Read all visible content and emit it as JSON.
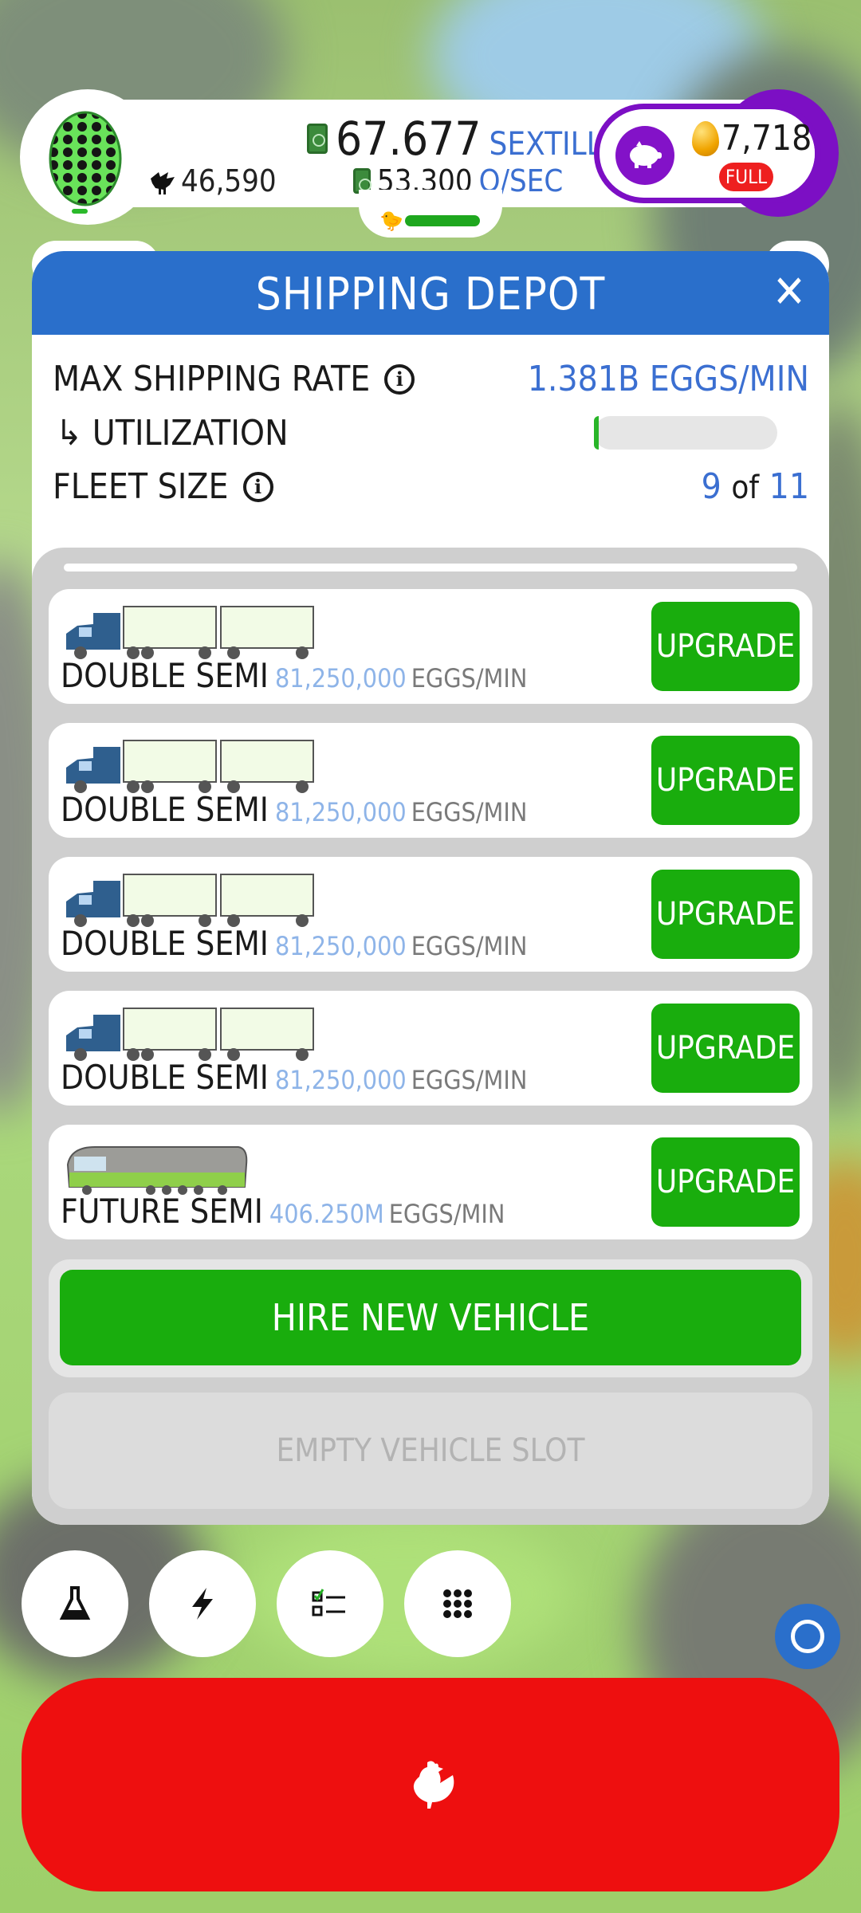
{
  "hud": {
    "chicken_count": "46,590",
    "money_amount": "67.677",
    "money_unit": "SEXTILLION",
    "rate_amount": "53.300",
    "rate_unit": "Q/SEC",
    "golden_eggs": "7,718",
    "bank_status": "FULL",
    "habitat_fill": 1.0
  },
  "panel": {
    "title": "SHIPPING DEPOT",
    "close": "✕",
    "max_rate_label": "MAX SHIPPING RATE",
    "max_rate_value": "1.381B EGGS/MIN",
    "utilization_label": "↳ UTILIZATION",
    "utilization_fraction": 0.02,
    "fleet_label": "FLEET SIZE",
    "fleet_count": "9",
    "fleet_of": "of",
    "fleet_max": "11"
  },
  "vehicles": [
    {
      "name": "DOUBLE SEMI",
      "rate": "81,250,000",
      "unit": "EGGS/MIN",
      "button": "UPGRADE"
    },
    {
      "name": "DOUBLE SEMI",
      "rate": "81,250,000",
      "unit": "EGGS/MIN",
      "button": "UPGRADE"
    },
    {
      "name": "DOUBLE SEMI",
      "rate": "81,250,000",
      "unit": "EGGS/MIN",
      "button": "UPGRADE"
    },
    {
      "name": "DOUBLE SEMI",
      "rate": "81,250,000",
      "unit": "EGGS/MIN",
      "button": "UPGRADE"
    },
    {
      "name": "FUTURE SEMI",
      "rate": "406.250M",
      "unit": "EGGS/MIN",
      "button": "UPGRADE"
    }
  ],
  "actions": {
    "hire_label": "HIRE NEW VEHICLE",
    "empty_slot_label": "EMPTY VEHICLE SLOT"
  },
  "tools": [
    {
      "icon": "flask-icon"
    },
    {
      "icon": "lightning-icon"
    },
    {
      "icon": "checklist-icon"
    },
    {
      "icon": "grid-menu-icon"
    }
  ],
  "colors": {
    "header_blue": "#2a6fcb",
    "upgrade_green": "#19ad0d",
    "hatch_red": "#ee0f0f",
    "bank_purple": "#7c0fc4"
  }
}
